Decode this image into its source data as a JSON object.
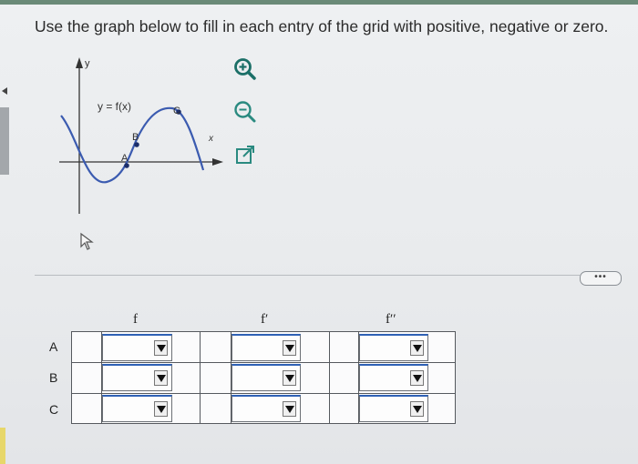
{
  "instruction": "Use the graph below to fill in each entry of the grid with positive, negative or zero.",
  "graph": {
    "y_axis_label": "y",
    "x_axis_label": "x",
    "function_label": "y = f(x)",
    "points": {
      "a": "A",
      "b": "B",
      "c": "C"
    }
  },
  "tools": {
    "zoom_in": "zoom-in-icon",
    "zoom_out": "zoom-out-icon",
    "popout": "popout-icon"
  },
  "more_button": "•••",
  "grid": {
    "columns": [
      "f",
      "f′",
      "f′′"
    ],
    "rows": [
      "A",
      "B",
      "C"
    ],
    "selected_values": [
      [
        "",
        "",
        ""
      ],
      [
        "",
        "",
        ""
      ],
      [
        "",
        "",
        ""
      ]
    ]
  },
  "colors": {
    "curve": "#3b5bb0",
    "accent": "#2f61b5"
  }
}
